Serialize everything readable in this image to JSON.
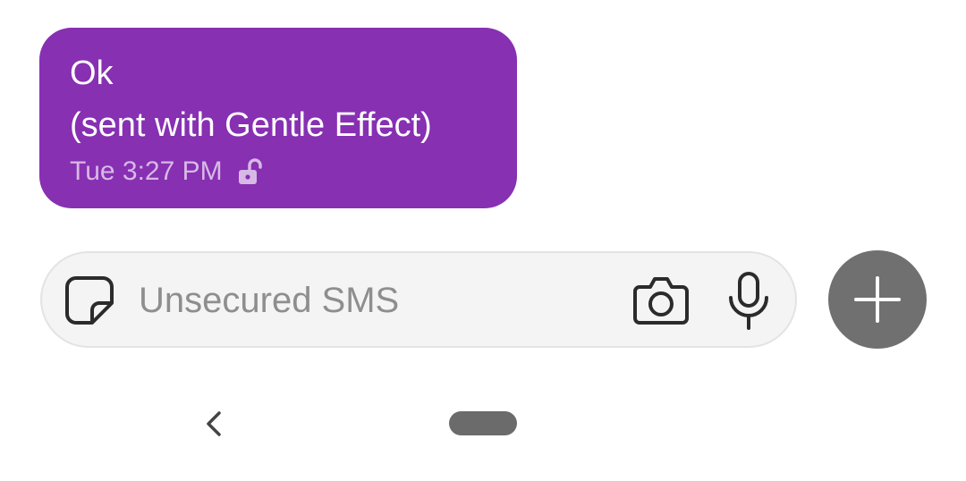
{
  "message": {
    "text": "Ok\n(sent with Gentle Effect)",
    "timestamp": "Tue 3:27 PM",
    "status_icon": "unlocked-lock-icon",
    "bubble_color": "#8730b2"
  },
  "composer": {
    "placeholder": "Unsecured SMS",
    "value": "",
    "sticker_icon": "sticker-icon",
    "camera_icon": "camera-icon",
    "mic_icon": "microphone-icon"
  },
  "attach_button": {
    "icon": "plus-icon",
    "color": "#707070"
  },
  "navigation": {
    "back_icon": "back-chevron-icon",
    "home_icon": "home-pill"
  }
}
